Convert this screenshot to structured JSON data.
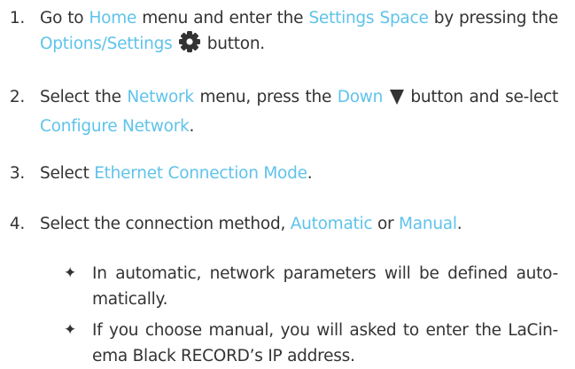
{
  "steps": [
    {
      "num": "1.",
      "t1": "Go to ",
      "h1": "Home",
      "t2": " menu and enter the ",
      "h2": "Settings Space",
      "t3": " by pressing the ",
      "h3": "Options/Settings",
      "icon": "gear-icon",
      "t4": " button."
    },
    {
      "num": "2.",
      "t1": "Select the ",
      "h1": "Network",
      "t2": " menu, press the ",
      "h2": "Down",
      "icon": "down-triangle-icon",
      "t3": " button and se-lect ",
      "h3": "Configure Network",
      "t4": "."
    },
    {
      "num": "3.",
      "t1": "Select ",
      "h1": "Ethernet Connection Mode",
      "t2": "."
    },
    {
      "num": "4.",
      "t1": "Select the connection method, ",
      "h1": "Automatic",
      "t2": " or ",
      "h2": "Manual",
      "t3": "."
    }
  ],
  "bullets": [
    {
      "marker": "✦",
      "text": "In automatic, network parameters will be defined auto-matically."
    },
    {
      "marker": "✦",
      "text": "If you choose manual, you will asked to enter the LaCin-ema Black RECORD’s IP address."
    }
  ],
  "colors": {
    "highlight": "#5fc3ea",
    "text": "#333333",
    "icon": "#333333"
  }
}
